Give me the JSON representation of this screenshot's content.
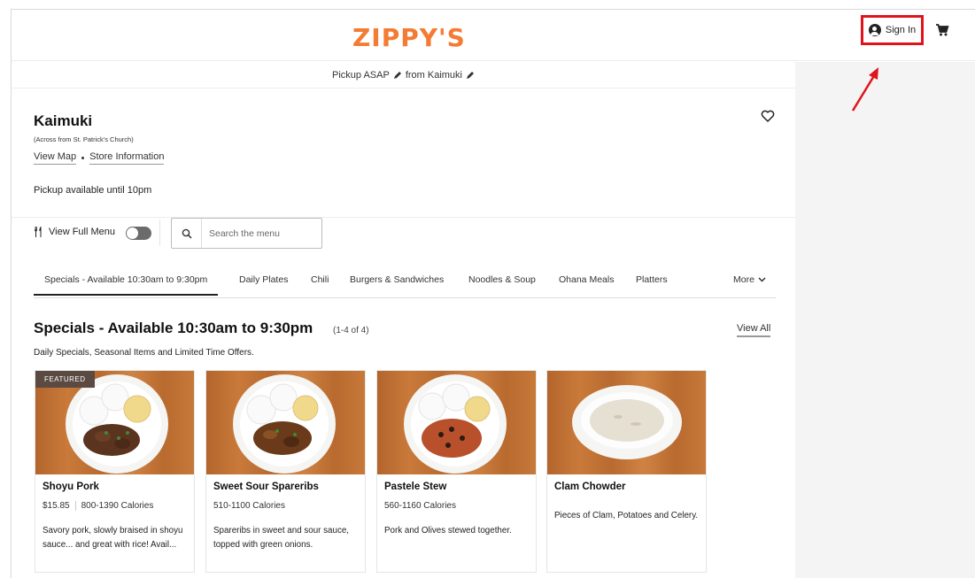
{
  "header": {
    "logo": "ZIPPY'S",
    "signin_label": "Sign In"
  },
  "pickup_bar": {
    "pickup": "Pickup ASAP",
    "from": "from Kaimuki"
  },
  "store": {
    "name": "Kaimuki",
    "subtitle": "(Across from St. Patrick's Church)",
    "view_map": "View Map",
    "store_info": "Store Information",
    "pickup_until": "Pickup available until 10pm"
  },
  "menu_controls": {
    "full_menu_label": "View Full Menu",
    "search_placeholder": "Search the menu"
  },
  "tabs": [
    {
      "label": "Specials - Available 10:30am to 9:30pm"
    },
    {
      "label": "Daily Plates"
    },
    {
      "label": "Chili"
    },
    {
      "label": "Burgers & Sandwiches"
    },
    {
      "label": "Noodles & Soup"
    },
    {
      "label": "Ohana Meals"
    },
    {
      "label": "Platters"
    }
  ],
  "more_label": "More",
  "section": {
    "title": "Specials - Available 10:30am to 9:30pm",
    "count": "(1-4 of 4)",
    "view_all": "View All",
    "description": "Daily Specials, Seasonal Items and Limited Time Offers."
  },
  "cards": [
    {
      "badge": "FEATURED",
      "name": "Shoyu Pork",
      "price": "$15.85",
      "calories": "800-1390 Calories",
      "description": "Savory pork, slowly braised in shoyu sauce... and great with rice! Avail..."
    },
    {
      "name": "Sweet Sour Spareribs",
      "calories": "510-1100 Calories",
      "description": "Spareribs in sweet and sour sauce, topped with green onions."
    },
    {
      "name": "Pastele Stew",
      "calories": "560-1160 Calories",
      "description": "Pork and Olives stewed together."
    },
    {
      "name": "Clam Chowder",
      "description": "Pieces of Clam, Potatoes and Celery."
    }
  ],
  "colors": {
    "brand": "#f47b33",
    "highlight": "#e0141c"
  }
}
